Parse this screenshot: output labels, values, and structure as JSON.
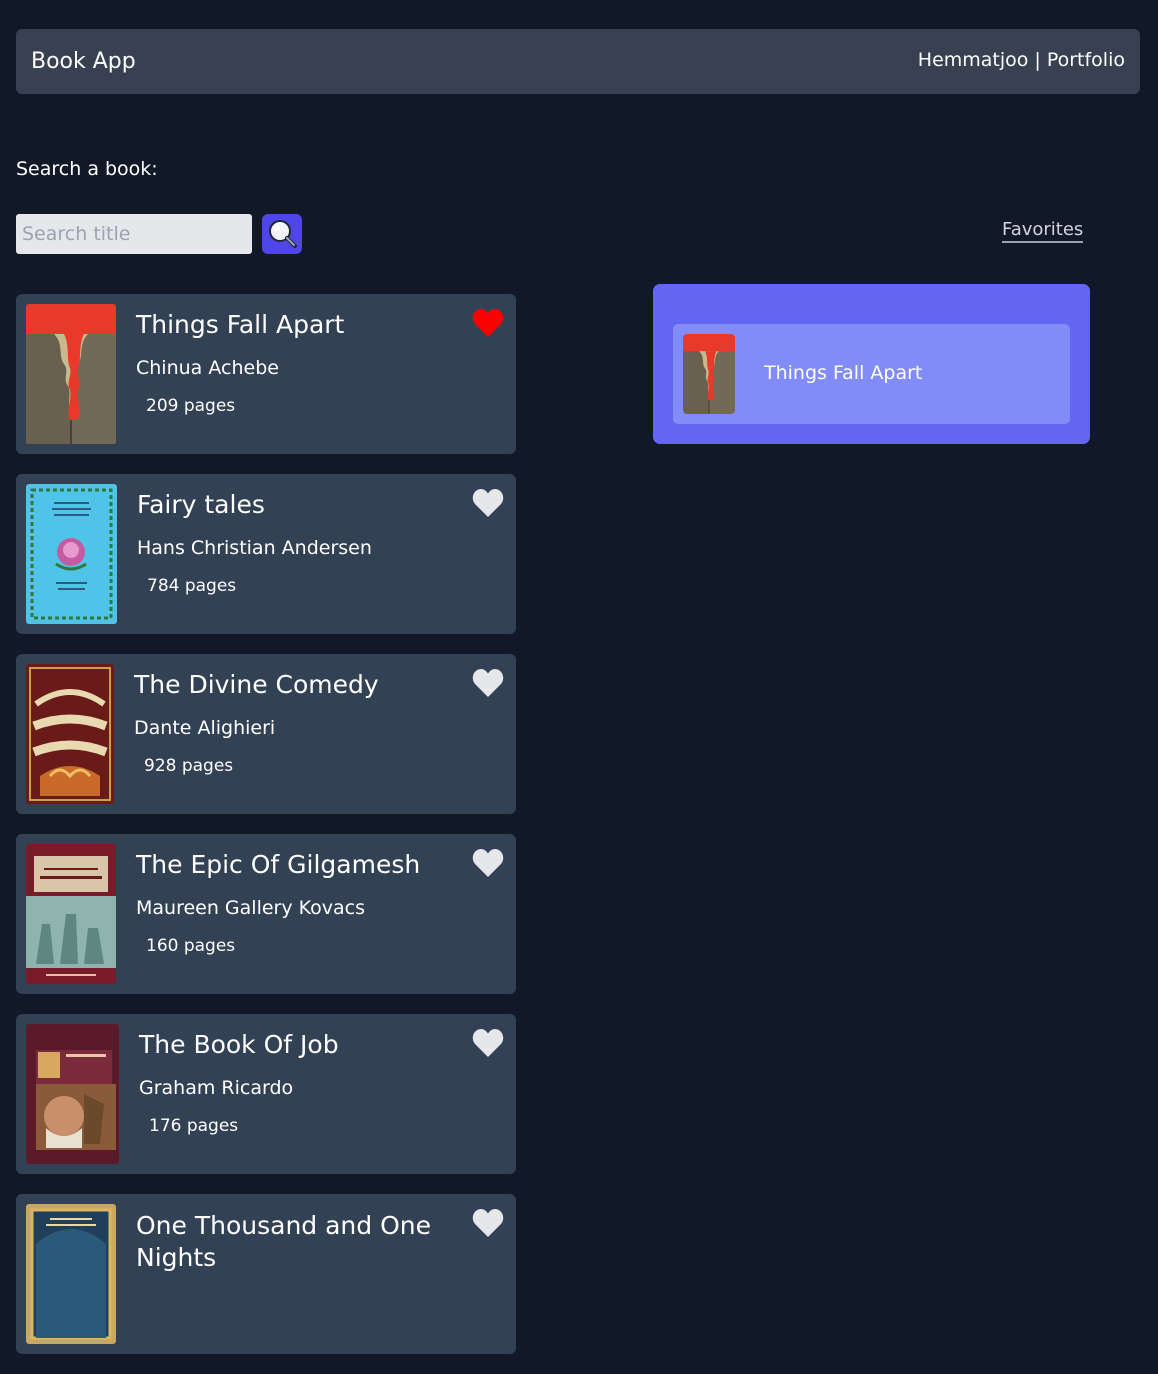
{
  "navbar": {
    "brand": "Book App",
    "link_author": "Hemmatjoo",
    "separator": "|",
    "link_portfolio": "Portfolio"
  },
  "search": {
    "label": "Search a book:",
    "placeholder": "Search title",
    "button_icon": "magnifier-icon"
  },
  "favorites_link": "Favorites",
  "books": [
    {
      "title": "Things Fall Apart",
      "author": "Chinua Achebe",
      "pages": "209 pages",
      "favorite": true
    },
    {
      "title": "Fairy tales",
      "author": "Hans Christian Andersen",
      "pages": "784 pages",
      "favorite": false
    },
    {
      "title": "The Divine Comedy",
      "author": "Dante Alighieri",
      "pages": "928 pages",
      "favorite": false
    },
    {
      "title": "The Epic Of Gilgamesh",
      "author": "Maureen Gallery Kovacs",
      "pages": "160 pages",
      "favorite": false
    },
    {
      "title": "The Book Of Job",
      "author": "Graham Ricardo",
      "pages": "176 pages",
      "favorite": false
    },
    {
      "title": "One Thousand and One Nights",
      "author": "",
      "pages": "",
      "favorite": false
    }
  ],
  "favorites": [
    {
      "title": "Things Fall Apart"
    }
  ],
  "colors": {
    "background": "#111827",
    "card": "#334155",
    "navbar": "#374151",
    "accent": "#6366f1",
    "heart_active": "#ff0000",
    "heart_inactive": "#e5e7eb"
  }
}
